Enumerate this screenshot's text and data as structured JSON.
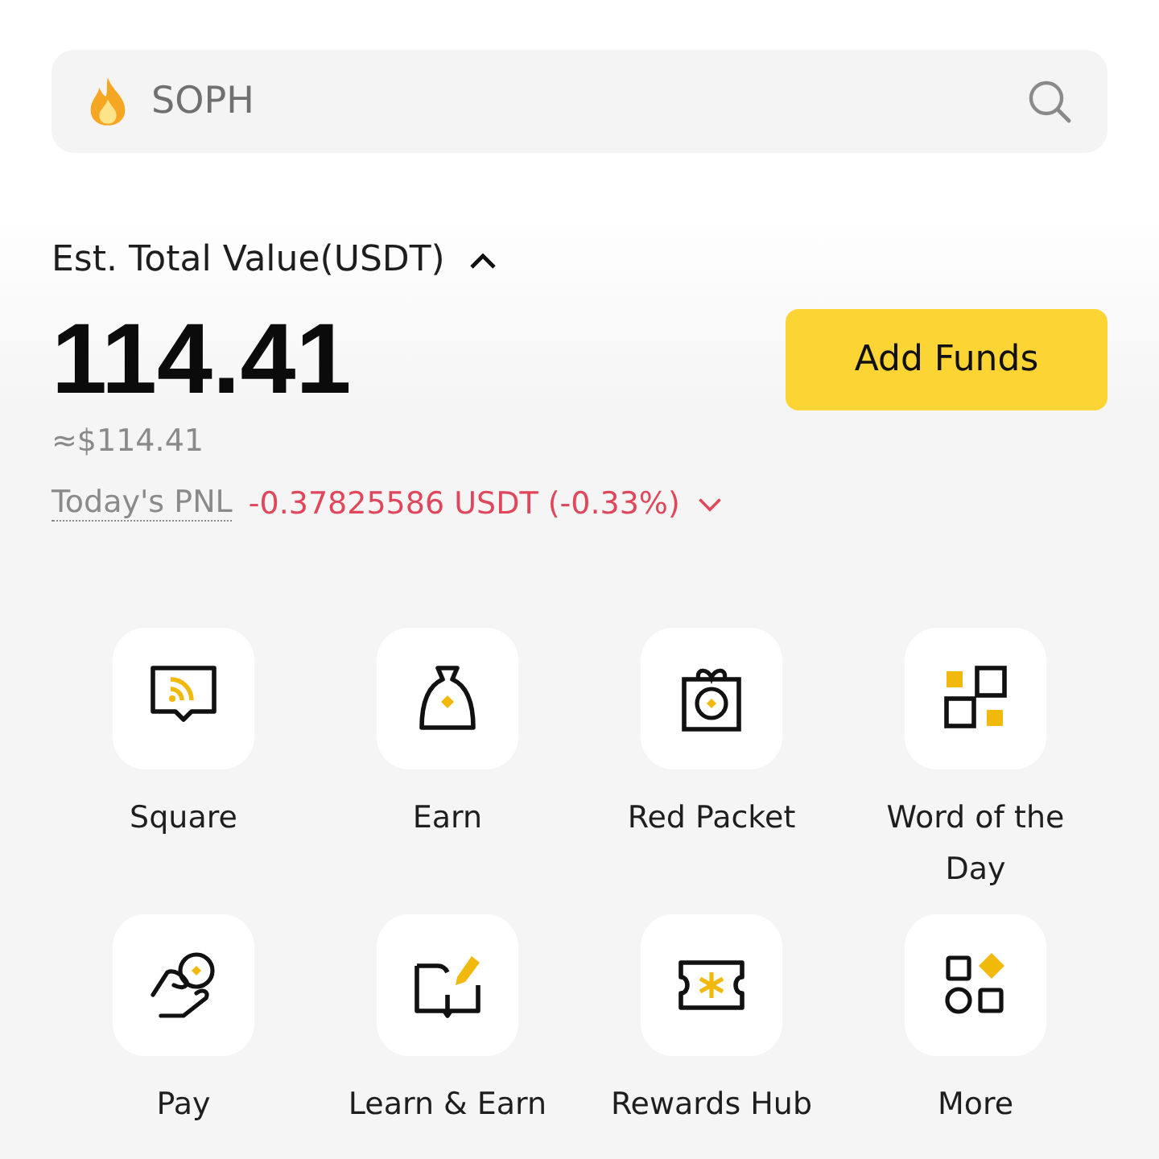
{
  "search": {
    "placeholder": "SOPH"
  },
  "balance": {
    "label": "Est. Total Value(USDT)",
    "expanded": true,
    "amount": "114.41",
    "fiat": "≈$114.41",
    "button": "Add Funds"
  },
  "pnl": {
    "label": "Today's PNL",
    "value": "-0.37825586 USDT (-0.33%)"
  },
  "shortcuts": [
    {
      "label": "Square"
    },
    {
      "label": "Earn"
    },
    {
      "label": "Red Packet"
    },
    {
      "label": "Word of the Day"
    },
    {
      "label": "Pay"
    },
    {
      "label": "Learn & Earn"
    },
    {
      "label": "Rewards Hub"
    },
    {
      "label": "More"
    }
  ]
}
